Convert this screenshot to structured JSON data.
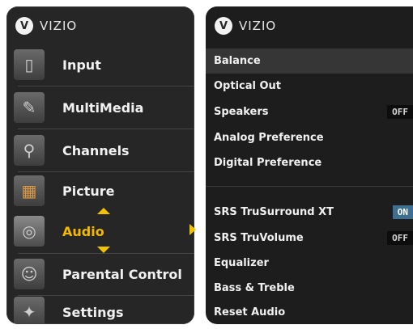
{
  "brand": {
    "name": "VIZIO",
    "logo_glyph": "V"
  },
  "main_menu": {
    "items": [
      {
        "label": "Input",
        "icon": "input-icon"
      },
      {
        "label": "MultiMedia",
        "icon": "multimedia-icon"
      },
      {
        "label": "Channels",
        "icon": "channels-icon"
      },
      {
        "label": "Picture",
        "icon": "picture-icon"
      },
      {
        "label": "Audio",
        "icon": "audio-icon",
        "active": true
      },
      {
        "label": "Parental Control",
        "icon": "parental-control-icon"
      },
      {
        "label": "Settings",
        "icon": "settings-icon"
      }
    ],
    "accent_color": "#f5b800"
  },
  "audio_menu": {
    "items": [
      {
        "label": "Balance"
      },
      {
        "label": "Optical Out"
      },
      {
        "label": "Speakers",
        "value": "OFF"
      },
      {
        "label": "Analog Preference"
      },
      {
        "label": "Digital Preference"
      },
      {
        "label": "SRS TruSurround XT",
        "value": "ON"
      },
      {
        "label": "SRS TruVolume",
        "value": "OFF"
      },
      {
        "label": "Equalizer"
      },
      {
        "label": "Bass & Treble"
      },
      {
        "label": "Reset Audio"
      }
    ],
    "on_color": "#3d6f8f"
  }
}
